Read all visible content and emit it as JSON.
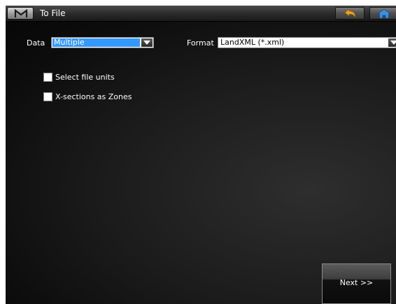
{
  "titlebar": {
    "menu_icon": "m-logo-icon",
    "title": "To File",
    "back_icon": "back-arrow-icon",
    "home_icon": "home-icon"
  },
  "form": {
    "data_label": "Data",
    "data_value": "Multiple",
    "format_label": "Format",
    "format_value": "LandXML (*.xml)",
    "options": [
      {
        "label": "Select file units",
        "checked": false
      },
      {
        "label": "X-sections as Zones",
        "checked": false
      }
    ]
  },
  "footer": {
    "next_label": "Next >>"
  },
  "colors": {
    "selection": "#3399ff",
    "back_arrow": "#f0a020",
    "home": "#3a8ee0"
  }
}
